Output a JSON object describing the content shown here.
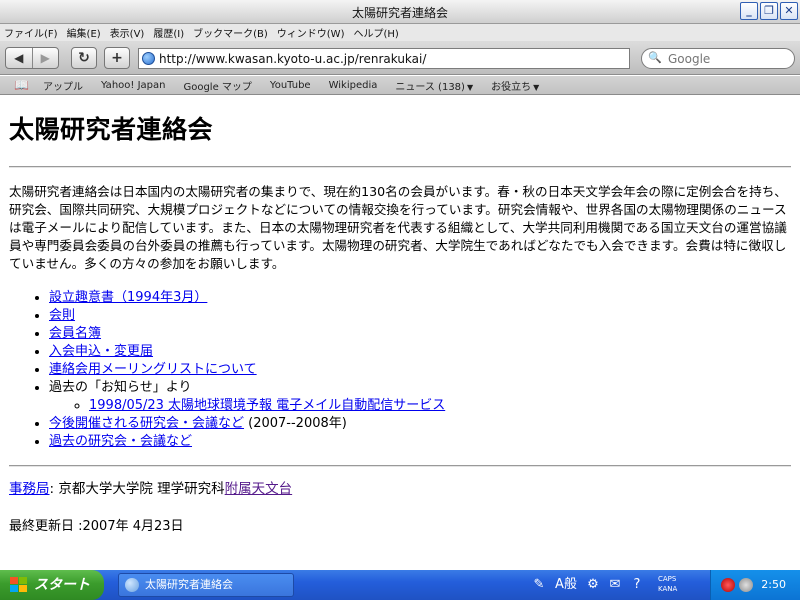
{
  "window": {
    "title": "太陽研究者連絡会"
  },
  "menu": [
    "ファイル(F)",
    "編集(E)",
    "表示(V)",
    "履歴(I)",
    "ブックマーク(B)",
    "ウィンドウ(W)",
    "ヘルプ(H)"
  ],
  "toolbar": {
    "back": "◀",
    "forward": "▶",
    "reload": "↻",
    "add": "+",
    "url": "http://www.kwasan.kyoto-u.ac.jp/renrakukai/",
    "search_placeholder": "Google"
  },
  "bookmarks": [
    {
      "label": "アップル",
      "has_menu": false
    },
    {
      "label": "Yahoo! Japan",
      "has_menu": false
    },
    {
      "label": "Google マップ",
      "has_menu": false
    },
    {
      "label": "YouTube",
      "has_menu": false
    },
    {
      "label": "Wikipedia",
      "has_menu": false
    },
    {
      "label": "ニュース (138)",
      "has_menu": true
    },
    {
      "label": "お役立ち",
      "has_menu": true
    }
  ],
  "page": {
    "heading": "太陽研究者連絡会",
    "intro": "太陽研究者連絡会は日本国内の太陽研究者の集まりで、現在約130名の会員がいます。春・秋の日本天文学会年会の際に定例会合を持ち、研究会、国際共同研究、大規模プロジェクトなどについての情報交換を行っています。研究会情報や、世界各国の太陽物理関係のニュースは電子メールにより配信しています。また、日本の太陽物理研究者を代表する組織として、大学共同利用機関である国立天文台の運営協議員や専門委員会委員の台外委員の推薦も行っています。太陽物理の研究者、大学院生であればどなたでも入会できます。会費は特に徴収していません。多くの方々の参加をお願いします。",
    "links": {
      "l1": "設立趣意書（1994年3月）",
      "l2": "会則",
      "l3": "会員名簿",
      "l4": "入会申込・変更届",
      "l5": "連絡会用メーリングリストについて",
      "l6": "過去の「お知らせ」より",
      "l6a": "1998/05/23 太陽地球環境予報 電子メイル自動配信サービス",
      "l7": "今後開催される研究会・会議など",
      "l7_suffix": " (2007--2008年)",
      "l8": "過去の研究会・会議など"
    },
    "office_link": "事務局",
    "office_text": ": 京都大学大学院 理学研究科",
    "office_link2": "附属天文台",
    "updated": "最終更新日 :2007年 4月23日"
  },
  "taskbar": {
    "start": "スタート",
    "task_title": "太陽研究者連絡会",
    "ime_label": "A般",
    "caps": "CAPS",
    "kana": "KANA",
    "clock": "2:50"
  }
}
